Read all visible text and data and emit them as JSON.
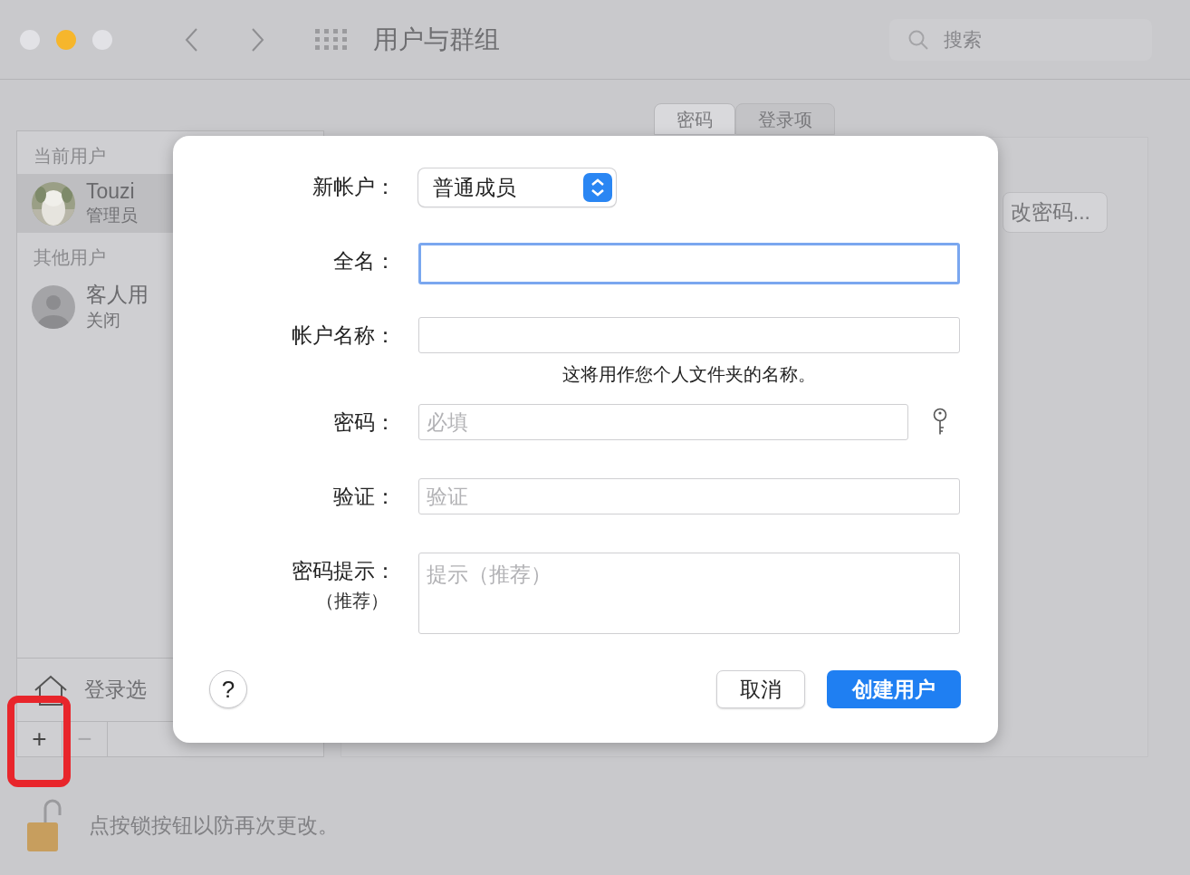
{
  "window": {
    "title": "用户与群组",
    "traffic_lights": [
      {
        "color": "#e2e2e6"
      },
      {
        "color": "#f6b62c"
      },
      {
        "color": "#e2e2e6"
      }
    ]
  },
  "search": {
    "placeholder": "搜索"
  },
  "sidebar": {
    "sections": [
      {
        "header": "当前用户",
        "users": [
          {
            "name": "Touzi",
            "role": "管理员",
            "selected": true
          }
        ]
      },
      {
        "header": "其他用户",
        "users": [
          {
            "name": "客人用",
            "role": "关闭",
            "kind": "guest",
            "selected": false
          }
        ]
      }
    ],
    "login_options": "登录选",
    "add_button": "+",
    "remove_button": "−"
  },
  "tabs": [
    {
      "label": "密码",
      "selected": true
    },
    {
      "label": "登录项",
      "selected": false
    }
  ],
  "change_password_button": "改密码...",
  "lock_text": "点按锁按钮以防再次更改。",
  "dialog": {
    "fields": [
      {
        "kind": "popup",
        "label": "新帐户：",
        "value": "普通成员"
      },
      {
        "kind": "text",
        "label": "全名：",
        "focused": true
      },
      {
        "kind": "text",
        "label": "帐户名称：",
        "focused": false,
        "note": "这将用作您个人文件夹的名称。"
      },
      {
        "kind": "password",
        "label": "密码：",
        "placeholder": "必填",
        "focused": false
      },
      {
        "kind": "text",
        "label": "验证：",
        "placeholder": "验证",
        "focused": false
      },
      {
        "kind": "textarea",
        "label": "密码提示：",
        "sublabel": "（推荐）",
        "placeholder": "提示（推荐）",
        "focused": false
      }
    ],
    "help_button": "?",
    "cancel_button": "取消",
    "create_button": "创建用户"
  },
  "highlight": {
    "color": "#e8252b"
  }
}
